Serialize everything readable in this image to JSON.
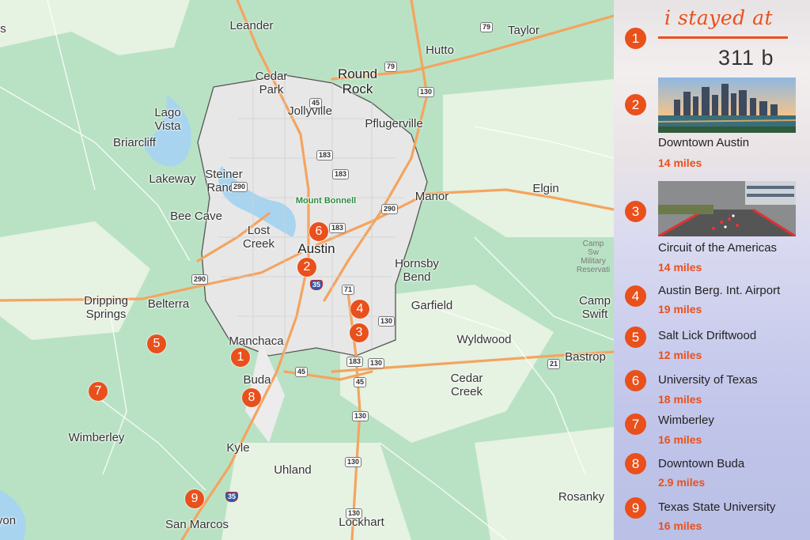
{
  "map": {
    "towns": [
      {
        "name": "Leander",
        "cls": "city"
      },
      {
        "name": "Taylor",
        "cls": "city"
      },
      {
        "name": "Hutto",
        "cls": "city"
      },
      {
        "name": "Round\nRock",
        "cls": "big"
      },
      {
        "name": "Cedar\nPark",
        "cls": "city"
      },
      {
        "name": "Jollyville",
        "cls": "city"
      },
      {
        "name": "Pflugerville",
        "cls": "city"
      },
      {
        "name": "Lago\nVista",
        "cls": "city"
      },
      {
        "name": "Briarcliff",
        "cls": "city"
      },
      {
        "name": "Steiner\nRanch",
        "cls": "city"
      },
      {
        "name": "Lakeway",
        "cls": "city"
      },
      {
        "name": "Bee Cave",
        "cls": "city"
      },
      {
        "name": "Lost\nCreek",
        "cls": "city"
      },
      {
        "name": "Austin",
        "cls": "big"
      },
      {
        "name": "Manor",
        "cls": "city"
      },
      {
        "name": "Elgin",
        "cls": "city"
      },
      {
        "name": "Hornsby\nBend",
        "cls": "city"
      },
      {
        "name": "Dripping\nSprings",
        "cls": "city"
      },
      {
        "name": "Belterra",
        "cls": "city"
      },
      {
        "name": "Manchaca",
        "cls": "city"
      },
      {
        "name": "Garfield",
        "cls": "city"
      },
      {
        "name": "Camp\nSwift",
        "cls": "city"
      },
      {
        "name": "Wyldwood",
        "cls": "city"
      },
      {
        "name": "Bastrop",
        "cls": "city"
      },
      {
        "name": "Buda",
        "cls": "city"
      },
      {
        "name": "Cedar\nCreek",
        "cls": "city"
      },
      {
        "name": "Wimberley",
        "cls": "city"
      },
      {
        "name": "Kyle",
        "cls": "city"
      },
      {
        "name": "Uhland",
        "cls": "city"
      },
      {
        "name": "Rosanky",
        "cls": "city"
      },
      {
        "name": "San Marcos",
        "cls": "city"
      },
      {
        "name": "Lockhart",
        "cls": "city"
      },
      {
        "name": "yon",
        "cls": "city"
      },
      {
        "name": "s",
        "cls": "city"
      },
      {
        "name": "Camp Sw\nMilitary\nReservati",
        "cls": "mil"
      },
      {
        "name": "Mount Bonnell",
        "cls": "park"
      }
    ],
    "shields": [
      "79",
      "79",
      "130",
      "45",
      "183",
      "183",
      "290",
      "290",
      "290",
      "183",
      "71",
      "35",
      "130",
      "130",
      "183",
      "130",
      "45",
      "45",
      "21",
      "130",
      "130",
      "35"
    ],
    "markers": [
      "1",
      "2",
      "3",
      "4",
      "5",
      "6",
      "7",
      "8",
      "9"
    ]
  },
  "panel": {
    "headline": "i stayed at",
    "address": "311 b",
    "header_number": "1",
    "items": [
      {
        "num": "2",
        "name": "Downtown Austin",
        "distance": "14 miles"
      },
      {
        "num": "3",
        "name": "Circuit of the Americas",
        "distance": "14 miles"
      },
      {
        "num": "4",
        "name": "Austin Berg. Int. Airport",
        "distance": "19 miles"
      },
      {
        "num": "5",
        "name": "Salt Lick Driftwood",
        "distance": "12 miles"
      },
      {
        "num": "6",
        "name": "University of Texas",
        "distance": "18 miles"
      },
      {
        "num": "7",
        "name": "Wimberley",
        "distance": "16 miles"
      },
      {
        "num": "8",
        "name": "Downtown Buda",
        "distance": "2.9 miles"
      },
      {
        "num": "9",
        "name": "Texas State University",
        "distance": "16 miles"
      }
    ]
  },
  "colors": {
    "accent": "#e9501c",
    "park_green": "#b9e2c4",
    "highway": "#f4a460",
    "water": "#a8d4ef"
  }
}
